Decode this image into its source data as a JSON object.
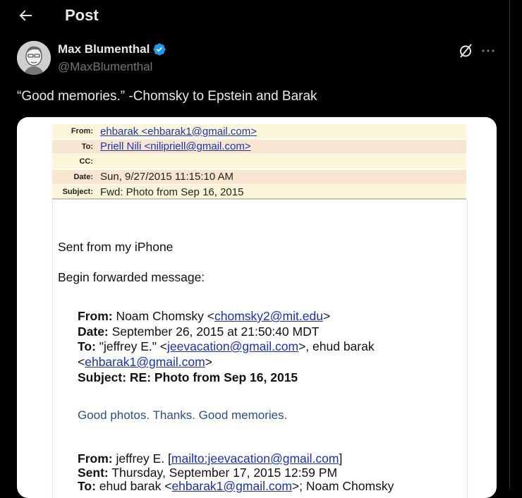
{
  "header": {
    "title": "Post"
  },
  "author": {
    "display_name": "Max Blumenthal",
    "handle": "@MaxBlumenthal"
  },
  "tweet": {
    "text": "“Good memories.” -Chomsky to Epstein and Barak"
  },
  "email": {
    "headers": [
      {
        "label": "From:",
        "value": "ehbarak <ehbarak1@gmail.com>",
        "link": true
      },
      {
        "label": "To:",
        "value": "Priell Nili <nilipriell@gmail.com>",
        "link": true
      },
      {
        "label": "CC:",
        "value": "",
        "link": false
      },
      {
        "label": "Date:",
        "value": "Sun, 9/27/2015 11:15:10 AM",
        "link": false
      },
      {
        "label": "Subject:",
        "value": "Fwd: Photo from Sep 16, 2015",
        "link": false
      }
    ],
    "sent_from": "Sent from my iPhone",
    "begin_forwarded": "Begin forwarded message:",
    "fwd1": {
      "from_label": "From:",
      "from_name": " Noam Chomsky <",
      "from_email": "chomsky2@mit.edu",
      "from_close": ">",
      "date_label": "Date:",
      "date_value": " September 26, 2015 at 21:50:40 MDT",
      "to_label": "To:",
      "to_pre": " \"jeffrey E.\" <",
      "to_email1": "jeevacation@gmail.com",
      "to_mid": ">, ehud barak",
      "to_line2_open": "<",
      "to_email2": "ehbarak1@gmail.com",
      "to_line2_close": ">",
      "subject_label": "Subject:",
      "subject_value": " RE: Photo from Sep 16, 2015"
    },
    "quote": "Good photos.  Thanks.  Good memories.",
    "fwd2": {
      "from_label": "From:",
      "from_pre": " jeffrey E. [",
      "from_link": "mailto:jeevacation@gmail.com",
      "from_close": "]",
      "sent_label": "Sent:",
      "sent_value": " Thursday, September 17, 2015 12:59 PM",
      "to_label": "To:",
      "to_pre": " ehud barak <",
      "to_email": "ehbarak1@gmail.com",
      "to_rest": ">; Noam Chomsky"
    }
  },
  "colors": {
    "accent": "#1d9bf0",
    "background": "#000000",
    "link": "#1a2fc0"
  }
}
